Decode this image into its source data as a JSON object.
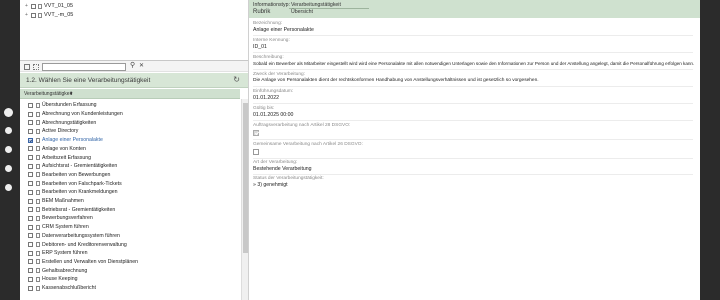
{
  "tree_top": [
    {
      "label": "VVT_01_05"
    },
    {
      "label": "VVT_-m_05"
    }
  ],
  "step": {
    "title": "1.2. Wählen Sie eine Verarbeitungstätigkeit",
    "column_label": "Verarbeitungstätigkeit"
  },
  "activities": [
    {
      "label": "Überstunden Erfassung",
      "checked": false
    },
    {
      "label": "Abrechnung von Kundenleistungen",
      "checked": false
    },
    {
      "label": "Abrechnungstätigkeiten",
      "checked": false
    },
    {
      "label": "Active Directory",
      "checked": false
    },
    {
      "label": "Anlage einer Personalakte",
      "checked": true
    },
    {
      "label": "Anlage von Konten",
      "checked": false
    },
    {
      "label": "Arbeitszeit Erfassung",
      "checked": false
    },
    {
      "label": "Aufsichtsrat - Gremientätigkeiten",
      "checked": false
    },
    {
      "label": "Bearbeiten von Bewerbungen",
      "checked": false
    },
    {
      "label": "Bearbeiten von Falschpark-Tickets",
      "checked": false
    },
    {
      "label": "Bearbeiten von Krankmeldungen",
      "checked": false
    },
    {
      "label": "BEM Maßnahmen",
      "checked": false
    },
    {
      "label": "Betriebsrat - Gremientätigkeiten",
      "checked": false
    },
    {
      "label": "Bewerbungsverfahren",
      "checked": false
    },
    {
      "label": "CRM System führen",
      "checked": false
    },
    {
      "label": "Datenverarbeitungssystem führen",
      "checked": false
    },
    {
      "label": "Debitoren- und Kreditorenverwaltung",
      "checked": false
    },
    {
      "label": "ERP System führen",
      "checked": false
    },
    {
      "label": "Erstellen und Verwalten von Dienstplänen",
      "checked": false
    },
    {
      "label": "Gehaltsabrechnung",
      "checked": false
    },
    {
      "label": "House Keeping",
      "checked": false
    },
    {
      "label": "Kassenabschlußbericht",
      "checked": false
    }
  ],
  "detail": {
    "info_type_label": "Informationstyp:",
    "info_type_value": "Verarbeitungstätigkeit",
    "rubric_label": "Rubrik",
    "rubric_value": "Übersicht",
    "fields": [
      {
        "label": "Bezeichnung:",
        "value": "Anlage einer Personalakte"
      },
      {
        "label": "Interne Kennung:",
        "value": "ID_01"
      },
      {
        "label": "Beschreibung:",
        "value": "Sobald ein Bewerber als Mitarbeiter eingestellt wird wird eine Personalakte mit allen notwendigen Unterlagen sowie den Informationen zur Person und der Anstellung angelegt, damit die Personalführung erfolgen kann."
      },
      {
        "label": "Zweck der Verarbeitung:",
        "value": "Die Anlage von Personalakten dient der rechtskonformen Handhabung von Anstellungsverhältnissen und ist gesetzlich so vorgesehen."
      },
      {
        "label": "Einführungsdatum:",
        "value": "01.01.2022"
      },
      {
        "label": "Gültig bis:",
        "value": "01.01.2025 00:00"
      },
      {
        "label": "Auftragsverarbeitung nach Artikel 28 DSGVO:",
        "value": ""
      },
      {
        "label": "Gemeinsame Verarbeitung nach Artikel 26 DSGVO:",
        "value": ""
      },
      {
        "label": "Art der Verarbeitung:",
        "value": "Bestehende Verarbeitung"
      },
      {
        "label": "Status der Verarbeitungstätigkeit:",
        "value": "» 3) genehmigt"
      }
    ],
    "auftrag_checked": true,
    "gemeinsam_checked": false
  },
  "icons": {
    "tree_view": "tree-view-icon",
    "list_view": "list-view-icon",
    "search": "search-icon",
    "clear": "clear-icon",
    "refresh": "refresh-icon",
    "sort": "sort-arrow-icon"
  },
  "colors": {
    "header_green": "#cfe1cf",
    "step_green": "#d7e6d6",
    "selected_text": "#3366a8"
  }
}
